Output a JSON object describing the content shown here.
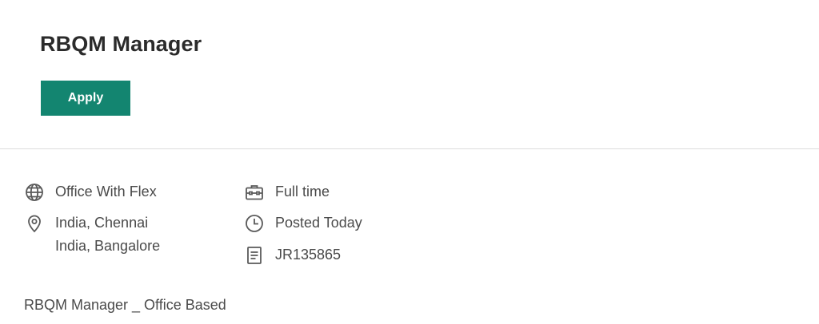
{
  "job": {
    "title": "RBQM Manager",
    "apply_label": "Apply",
    "work_type": "Office With Flex",
    "locations": [
      "India, Chennai",
      "India, Bangalore"
    ],
    "employment_type": "Full time",
    "posted": "Posted Today",
    "job_id": "JR135865",
    "description_heading": "RBQM Manager _ Office Based"
  },
  "icons": {
    "work_type": "globe-icon",
    "location": "location-pin-icon",
    "employment_type": "briefcase-icon",
    "posted": "clock-icon",
    "job_id": "document-icon"
  },
  "colors": {
    "accent": "#138570",
    "icon": "#5a5a5a",
    "text": "#4a4a4a"
  }
}
